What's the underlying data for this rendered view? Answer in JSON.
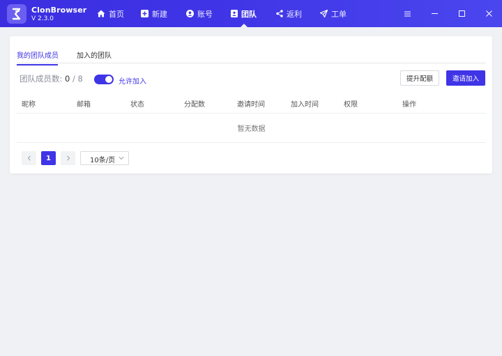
{
  "app": {
    "name": "ClonBrowser",
    "version": "V 2.3.0"
  },
  "nav": [
    {
      "label": "首页",
      "icon": "home-icon"
    },
    {
      "label": "新建",
      "icon": "plus-square-icon"
    },
    {
      "label": "账号",
      "icon": "user-circle-icon"
    },
    {
      "label": "团队",
      "icon": "team-badge-icon",
      "active": true
    },
    {
      "label": "返利",
      "icon": "share-icon"
    },
    {
      "label": "工单",
      "icon": "paper-plane-icon"
    }
  ],
  "window_controls": [
    "menu-icon",
    "minimize-icon",
    "maximize-icon",
    "close-icon"
  ],
  "tabs": {
    "my_members": "我的团队成员",
    "joined_teams": "加入的团队"
  },
  "members": {
    "label": "团队成员数:",
    "current": "0",
    "separator": "/",
    "max": "8"
  },
  "toggle": {
    "label": "允许加入",
    "on": true
  },
  "buttons": {
    "upgrade": "提升配额",
    "invite": "邀请加入"
  },
  "table": {
    "columns": [
      "昵称",
      "邮箱",
      "状态",
      "分配数",
      "邀请时间",
      "加入时间",
      "权限",
      "操作"
    ],
    "empty_text": "暂无数据"
  },
  "pagination": {
    "current_page": "1",
    "page_size": "10条/页"
  },
  "colors": {
    "accent": "#3f34e6",
    "background": "#f0f1f4"
  }
}
